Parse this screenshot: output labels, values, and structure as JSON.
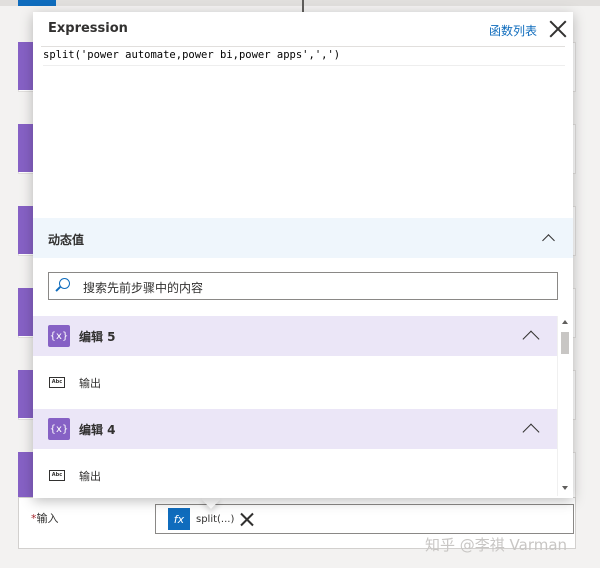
{
  "popup": {
    "title": "Expression",
    "function_list_link": "函数列表",
    "expression_text": "split('power automate,power bi,power apps',',')"
  },
  "dynamic": {
    "title": "动态值",
    "search_placeholder": "搜索先前步骤中的内容",
    "groups": [
      {
        "label": "编辑 5",
        "icon": "{x}",
        "item_label": "输出",
        "item_icon": "Abc"
      },
      {
        "label": "编辑 4",
        "icon": "{x}",
        "item_label": "输出",
        "item_icon": "Abc"
      }
    ]
  },
  "field": {
    "required_mark": "*",
    "label": "输入",
    "token_icon": "fx",
    "token_text": "split(...)"
  },
  "watermark": "知乎 @李祺 Varman",
  "colors": {
    "accent": "#0f6cbd",
    "action_purple": "#8661c5",
    "group_bg": "#ebe6f7"
  }
}
